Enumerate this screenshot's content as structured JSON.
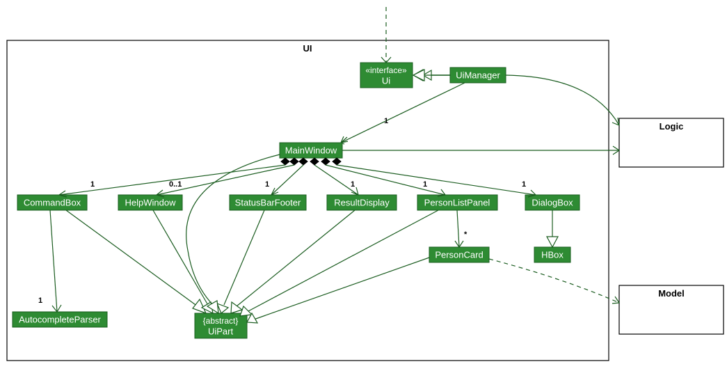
{
  "packages": {
    "ui": {
      "label": "UI"
    },
    "logic": {
      "label": "Logic"
    },
    "model": {
      "label": "Model"
    }
  },
  "classes": {
    "ui_interface": {
      "stereotype": "«interface»",
      "name": "Ui"
    },
    "ui_manager": {
      "name": "UiManager"
    },
    "main_window": {
      "name": "MainWindow"
    },
    "command_box": {
      "name": "CommandBox"
    },
    "help_window": {
      "name": "HelpWindow"
    },
    "status_bar_footer": {
      "name": "StatusBarFooter"
    },
    "result_display": {
      "name": "ResultDisplay"
    },
    "person_list_panel": {
      "name": "PersonListPanel"
    },
    "dialog_box": {
      "name": "DialogBox"
    },
    "person_card": {
      "name": "PersonCard"
    },
    "hbox": {
      "name": "HBox"
    },
    "autocomplete_parser": {
      "name": "AutocompleteParser"
    },
    "ui_part": {
      "stereotype": "{abstract}",
      "name": "UiPart"
    }
  },
  "multiplicities": {
    "main_window": "1",
    "command_box": "1",
    "help_window": "0..1",
    "status_bar_footer": "1",
    "result_display": "1",
    "person_list_panel": "1",
    "dialog_box": "1",
    "person_card": "*",
    "autocomplete_parser": "1"
  },
  "edges": [
    {
      "from": "external_top",
      "to": "ui_interface",
      "type": "dependency"
    },
    {
      "from": "ui_manager",
      "to": "ui_interface",
      "type": "realization"
    },
    {
      "from": "ui_manager",
      "to": "main_window",
      "type": "association",
      "mult_to": "1"
    },
    {
      "from": "ui_manager",
      "to": "logic",
      "type": "association_curved"
    },
    {
      "from": "main_window",
      "to": "logic",
      "type": "association"
    },
    {
      "from": "main_window",
      "to": "command_box",
      "type": "composition",
      "mult_to": "1"
    },
    {
      "from": "main_window",
      "to": "help_window",
      "type": "composition",
      "mult_to": "0..1"
    },
    {
      "from": "main_window",
      "to": "status_bar_footer",
      "type": "composition",
      "mult_to": "1"
    },
    {
      "from": "main_window",
      "to": "result_display",
      "type": "composition",
      "mult_to": "1"
    },
    {
      "from": "main_window",
      "to": "person_list_panel",
      "type": "composition",
      "mult_to": "1"
    },
    {
      "from": "main_window",
      "to": "dialog_box",
      "type": "composition",
      "mult_to": "1"
    },
    {
      "from": "person_list_panel",
      "to": "person_card",
      "type": "association",
      "mult_to": "*"
    },
    {
      "from": "dialog_box",
      "to": "hbox",
      "type": "generalization"
    },
    {
      "from": "main_window",
      "to": "ui_part",
      "type": "generalization_curved"
    },
    {
      "from": "command_box",
      "to": "ui_part",
      "type": "generalization"
    },
    {
      "from": "help_window",
      "to": "ui_part",
      "type": "generalization"
    },
    {
      "from": "status_bar_footer",
      "to": "ui_part",
      "type": "generalization"
    },
    {
      "from": "result_display",
      "to": "ui_part",
      "type": "generalization"
    },
    {
      "from": "person_list_panel",
      "to": "ui_part",
      "type": "generalization"
    },
    {
      "from": "person_card",
      "to": "ui_part",
      "type": "generalization"
    },
    {
      "from": "command_box",
      "to": "autocomplete_parser",
      "type": "association",
      "mult_to": "1"
    },
    {
      "from": "person_card",
      "to": "model",
      "type": "dependency_curved"
    }
  ],
  "colors": {
    "class_fill": "#2e8b33",
    "class_stroke": "#1a5c1f",
    "class_text": "#ffffff",
    "frame_stroke": "#000000",
    "edge": "#1a5c1f"
  }
}
